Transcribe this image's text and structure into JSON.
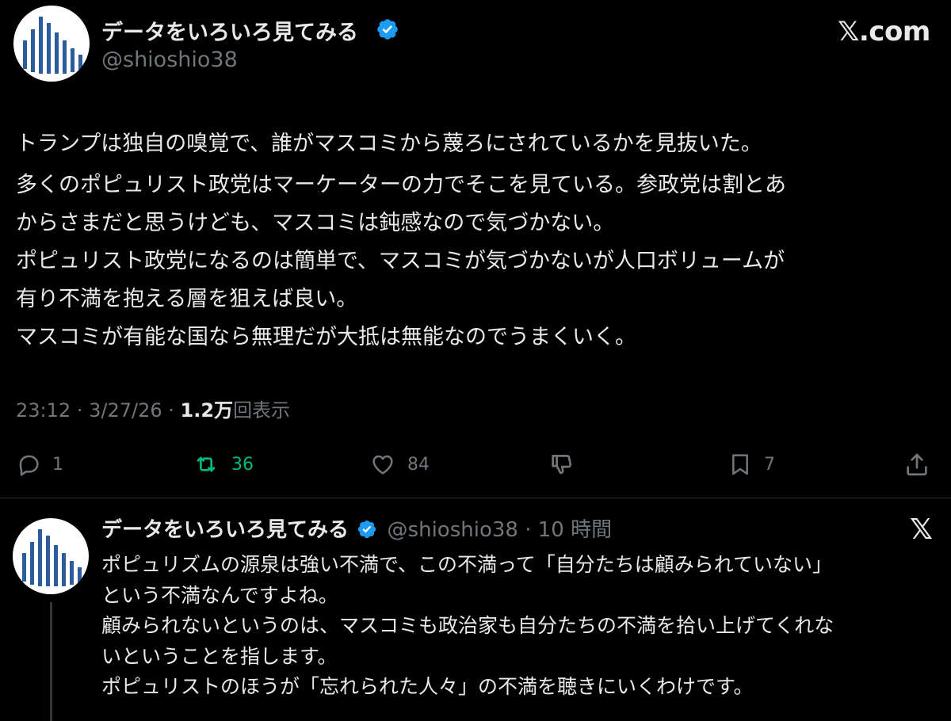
{
  "brand": {
    "site_label": "𝕏.com",
    "x_glyph": "𝕏"
  },
  "main_tweet": {
    "author_name": "データをいろいろ見てみる",
    "handle": "@shioshio38",
    "lines": [
      "トランプは独自の嗅覚で、誰がマスコミから蔑ろにされているかを見抜いた。",
      "多くのポピュリスト政党はマーケーターの力でそこを見ている。参政党は割とあ",
      "からさまだと思うけども、マスコミは鈍感なので気づかない。",
      "ポピュリスト政党になるのは簡単で、マスコミが気づかないが人口ボリュームが",
      "有り不満を抱える層を狙えば良い。",
      "マスコミが有能な国なら無理だが大抵は無能なのでうまくいく。"
    ],
    "time": "23:12",
    "date": "3/27/26",
    "views_count": "1.2万",
    "views_label": "回表示",
    "separator": "·",
    "actions": {
      "replies": "1",
      "retweets": "36",
      "likes": "84",
      "bookmarks": "7"
    }
  },
  "reply_tweet": {
    "author_name": "データをいろいろ見てみる",
    "handle_time": "@shioshio38 · 10 時間",
    "lines": [
      "ポピュリズムの源泉は強い不満で、この不満って「自分たちは顧みられていない」",
      "という不満なんですよね。",
      "顧みられないというのは、マスコミも政治家も自分たちの不満を拾い上げてくれな",
      "いということを指します。",
      "ポピュリストのほうが「忘れられた人々」の不満を聴きにいくわけです。"
    ]
  },
  "colors": {
    "background": "#000000",
    "text": "#e7e9ea",
    "muted": "#71767b",
    "verified": "#1d9bf0",
    "retweet": "#00ba7c",
    "avatar_bars": "#2b5c9e"
  },
  "icons": [
    "verified-badge-icon",
    "reply-icon",
    "retweet-icon",
    "like-icon",
    "dislike-icon",
    "bookmark-icon",
    "share-icon",
    "x-logo-icon"
  ]
}
